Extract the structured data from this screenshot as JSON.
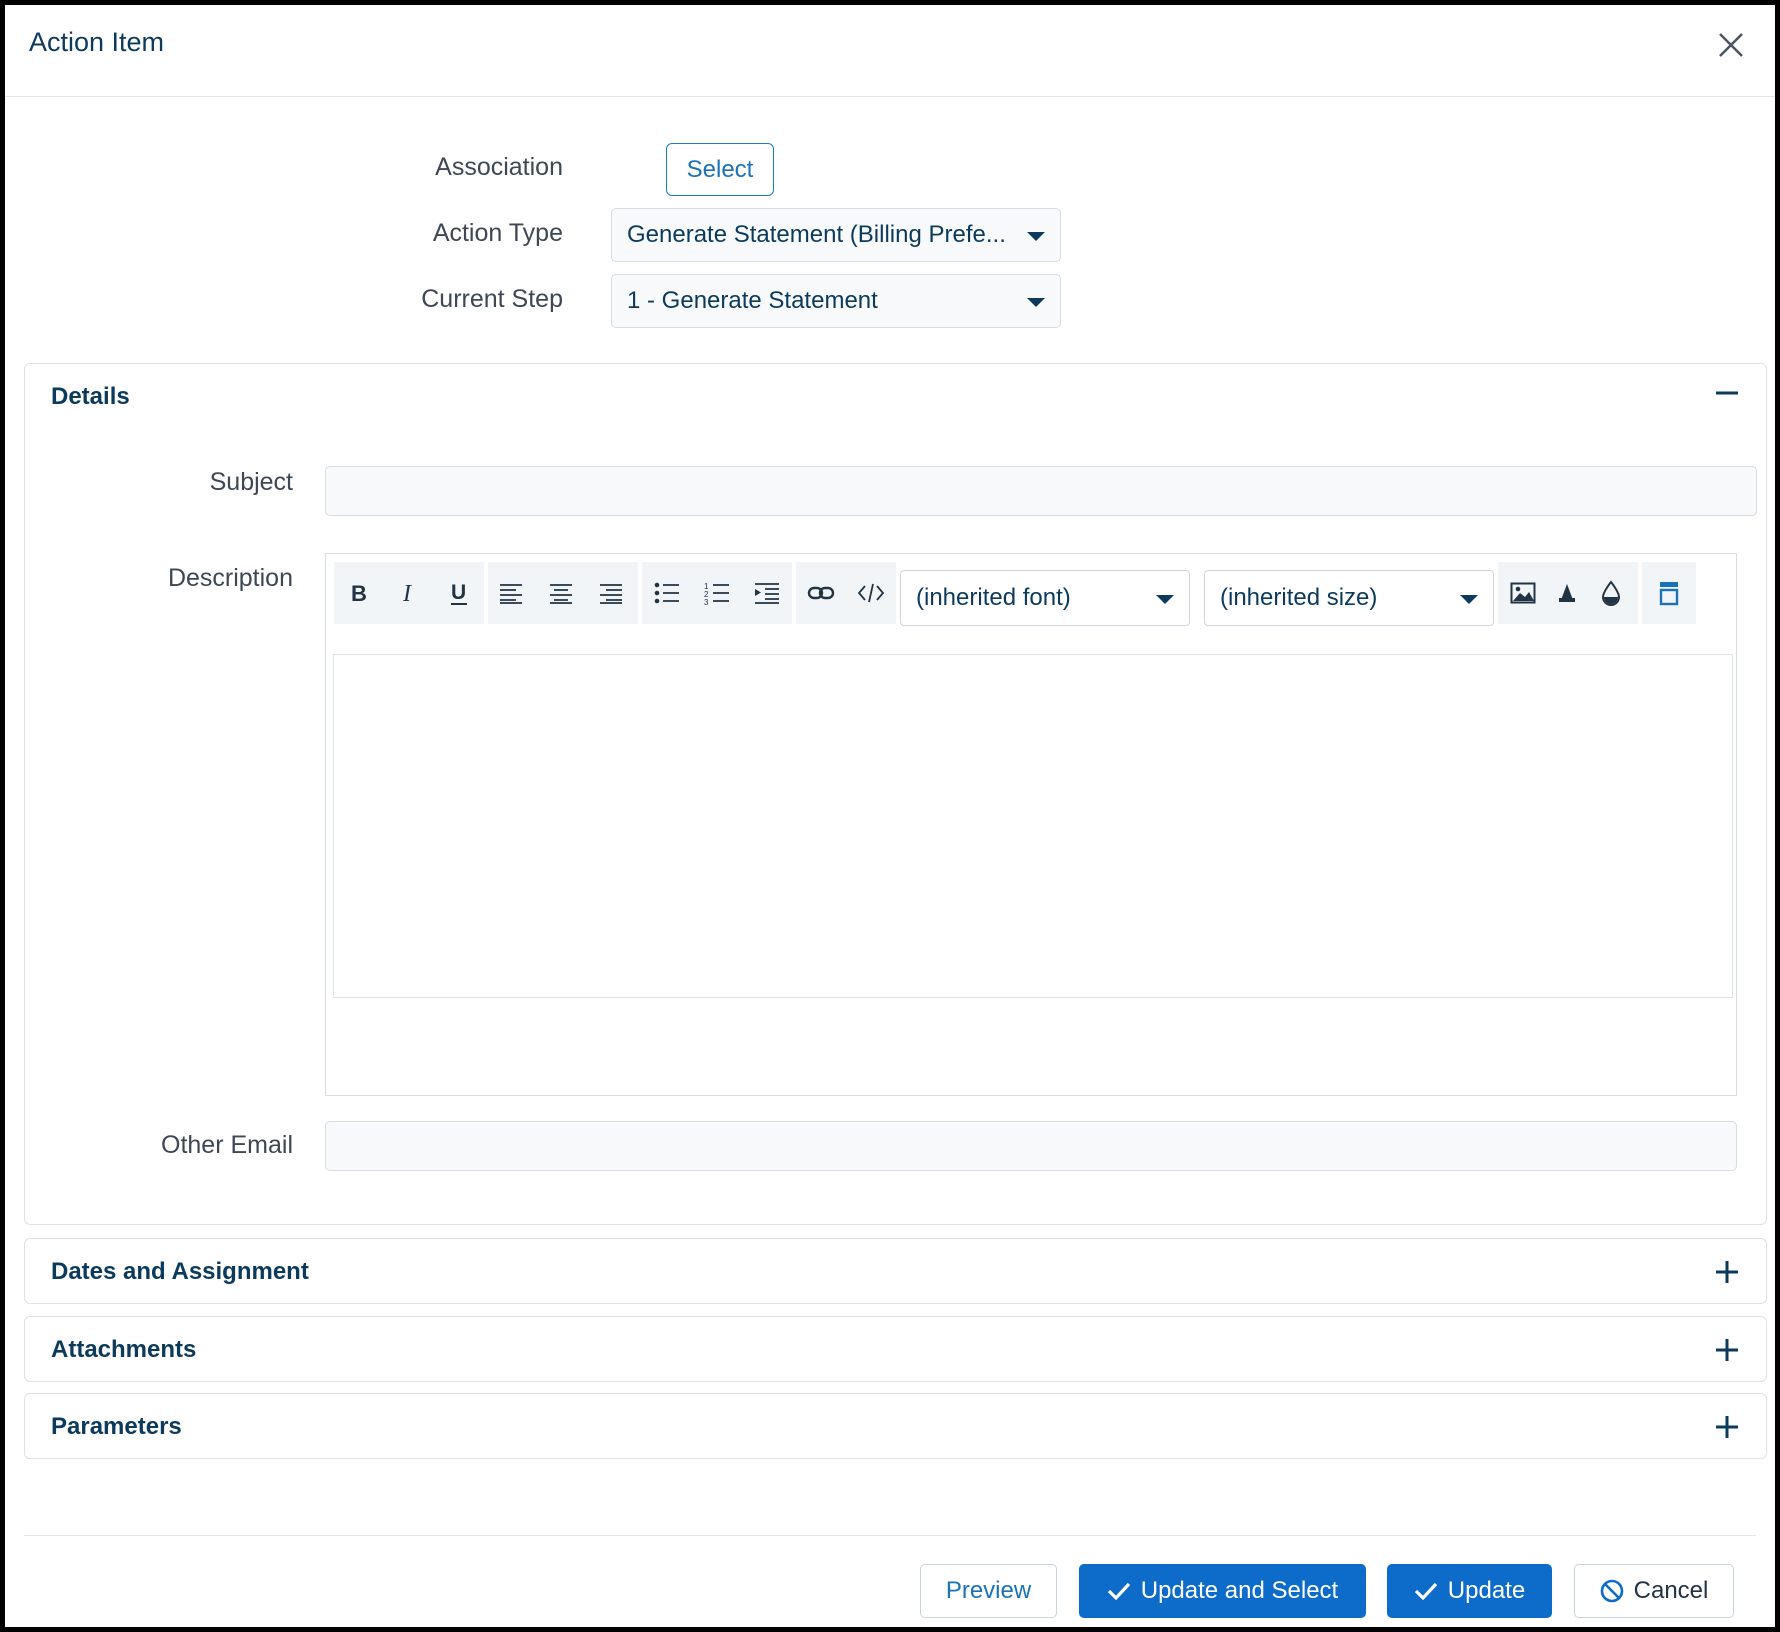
{
  "dialog": {
    "title": "Action Item"
  },
  "form": {
    "association_label": "Association",
    "association_button": "Select",
    "action_type_label": "Action Type",
    "action_type_value": "Generate Statement (Billing Prefe...",
    "current_step_label": "Current Step",
    "current_step_value": "1 - Generate Statement"
  },
  "details": {
    "title": "Details",
    "subject_label": "Subject",
    "subject_value": "",
    "description_label": "Description",
    "font_select": "(inherited font)",
    "size_select": "(inherited size)",
    "other_email_label": "Other Email",
    "other_email_value": ""
  },
  "sections": [
    {
      "title": "Dates and Assignment"
    },
    {
      "title": "Attachments"
    },
    {
      "title": "Parameters"
    }
  ],
  "footer": {
    "preview": "Preview",
    "update_and_select": "Update and Select",
    "update": "Update",
    "cancel": "Cancel"
  },
  "colors": {
    "primary": "#0d6bc9",
    "text": "#0b3a5c"
  }
}
